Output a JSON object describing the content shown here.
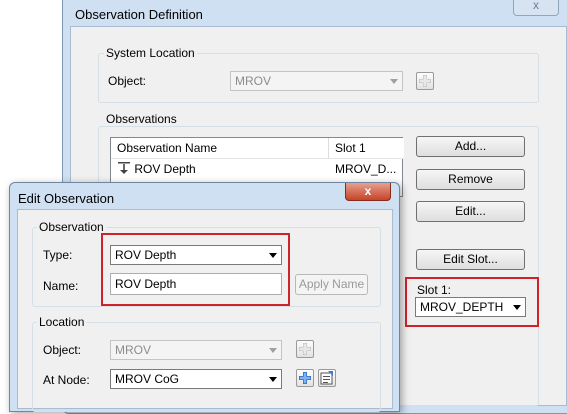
{
  "observation_definition": {
    "title": "Observation Definition",
    "close_glyph": "x",
    "system_location": {
      "group_label": "System Location",
      "object_label": "Object:",
      "object_value": "MROV"
    },
    "observations": {
      "group_label": "Observations",
      "columns": [
        "Observation Name",
        "Slot 1"
      ],
      "rows": [
        {
          "name": "ROV Depth",
          "slot1": "MROV_D..."
        }
      ],
      "buttons": {
        "add": "Add...",
        "remove": "Remove",
        "edit": "Edit...",
        "edit_slot": "Edit Slot..."
      },
      "slot_label": "Slot 1:",
      "slot_value": "MROV_DEPTH"
    }
  },
  "edit_observation": {
    "title": "Edit Observation",
    "close_glyph": "x",
    "observation": {
      "group_label": "Observation",
      "type_label": "Type:",
      "type_value": "ROV Depth",
      "name_label": "Name:",
      "name_value": "ROV Depth",
      "apply_name": "Apply Name"
    },
    "location": {
      "group_label": "Location",
      "object_label": "Object:",
      "object_value": "MROV",
      "node_label": "At Node:",
      "node_value": "MROV CoG"
    }
  },
  "colors": {
    "highlight": "#d1222b",
    "title_bar": "#cfe0f2",
    "dialog_body": "#f0f0f0"
  }
}
